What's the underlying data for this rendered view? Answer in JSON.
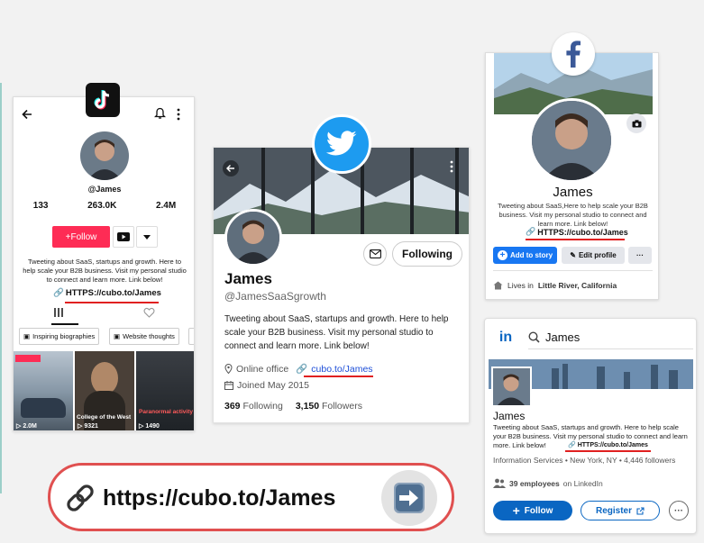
{
  "colors": {
    "tiktok_pink": "#fe2c55",
    "twitter_blue": "#1d9bf0",
    "facebook_blue": "#1877f2",
    "linkedin_blue": "#0a66c2",
    "highlight_red": "#e02020"
  },
  "tiktok": {
    "logo_icon": "tiktok-logo",
    "handle": "@James",
    "stats": [
      "133",
      "263.0K",
      "2.4M"
    ],
    "follow_label": "+Follow",
    "bio": "Tweeting about SaaS, startups and growth. Here to help scale your B2B business. Visit my personal studio to connect and learn more. Link below!",
    "link": "HTTPS://cubo.to/James",
    "chips": [
      "Inspiring biographies",
      "Website thoughts"
    ],
    "videos": [
      {
        "views": "2.0M",
        "caption": ""
      },
      {
        "views": "9321",
        "caption": "College of the West"
      },
      {
        "views": "1490",
        "caption": "Paranormal activity"
      }
    ]
  },
  "twitter": {
    "name": "James",
    "handle": "@JamesSaaSgrowth",
    "following_label": "Following",
    "bio": "Tweeting about SaaS, startups and growth. Here to help scale your B2B business. Visit my personal studio to connect and learn more. Link below!",
    "location": "Online office",
    "link": "cubo.to/James",
    "joined": "Joined May 2015",
    "following_count": "369",
    "following_label2": "Following",
    "followers_count": "3,150",
    "followers_label": "Followers"
  },
  "facebook": {
    "name": "James",
    "bio": "Tweeting about SaaS,Here to help scale your B2B business. Visit my personal studio to connect and learn more. Link below!",
    "link": "HTTPS://cubo.to/James",
    "add_story_label": "Add to story",
    "edit_profile_label": "Edit profile",
    "more_label": "···",
    "lives_in_prefix": "Lives in",
    "lives_in_place": "Little River, California"
  },
  "linkedin": {
    "search_value": "James",
    "name": "James",
    "bio": "Tweeting about SaaS, startups and growth. Here to help scale your B2B business. Visit my personal studio to connect and learn more. Link below!",
    "link": "HTTPS://cubo.to/James",
    "info": "Information Services • New York, NY • 4,446 followers",
    "employees_count": "39 employees",
    "employees_suffix": "on LinkedIn",
    "follow_label": "Follow",
    "register_label": "Register",
    "more_label": "···"
  },
  "url_bar": {
    "url": "https://cubo.to/James"
  }
}
